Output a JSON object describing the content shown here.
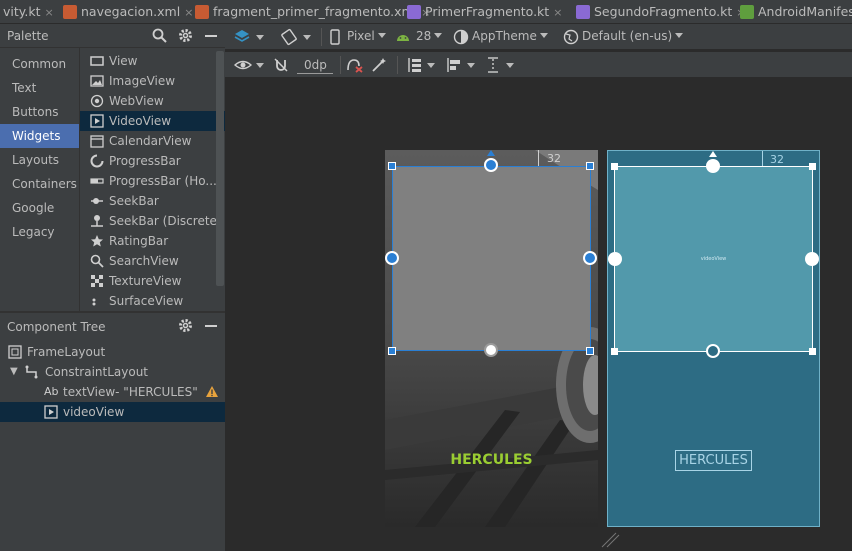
{
  "tabs": [
    {
      "label": "vity.kt"
    },
    {
      "label": "navegacion.xml"
    },
    {
      "label": "fragment_primer_fragmento.xml"
    },
    {
      "label": "PrimerFragmento.kt"
    },
    {
      "label": "SegundoFragmento.kt"
    },
    {
      "label": "AndroidManifest.x"
    }
  ],
  "palette": {
    "title": "Palette",
    "categories": [
      {
        "label": "Common"
      },
      {
        "label": "Text"
      },
      {
        "label": "Buttons"
      },
      {
        "label": "Widgets"
      },
      {
        "label": "Layouts"
      },
      {
        "label": "Containers"
      },
      {
        "label": "Google"
      },
      {
        "label": "Legacy"
      }
    ],
    "items": [
      {
        "label": "View"
      },
      {
        "label": "ImageView"
      },
      {
        "label": "WebView"
      },
      {
        "label": "VideoView"
      },
      {
        "label": "CalendarView"
      },
      {
        "label": "ProgressBar"
      },
      {
        "label": "ProgressBar (Ho..."
      },
      {
        "label": "SeekBar"
      },
      {
        "label": "SeekBar (Discrete)"
      },
      {
        "label": "RatingBar"
      },
      {
        "label": "SearchView"
      },
      {
        "label": "TextureView"
      },
      {
        "label": "SurfaceView"
      }
    ]
  },
  "component_tree": {
    "title": "Component Tree",
    "nodes": [
      {
        "label": "FrameLayout"
      },
      {
        "label": "ConstraintLayout"
      },
      {
        "label": "textView- \"HERCULES\""
      },
      {
        "label": "videoView"
      }
    ]
  },
  "toolbar": {
    "device": "Pixel",
    "api": "28",
    "theme": "AppTheme",
    "locale": "Default (en-us)",
    "margin": "0dp"
  },
  "design": {
    "margin_label": "32",
    "text": "HERCULES",
    "text_color": "#9acd32"
  },
  "blueprint": {
    "margin_label": "32",
    "view_label": "videoView",
    "text": "HERCULES"
  },
  "colors": {
    "selection": "#4b6eaf",
    "tree_selection": "#0d293e",
    "handle": "#2a7fd4",
    "blueprint_bg": "#2d6c84",
    "warning": "#e8a33d"
  }
}
